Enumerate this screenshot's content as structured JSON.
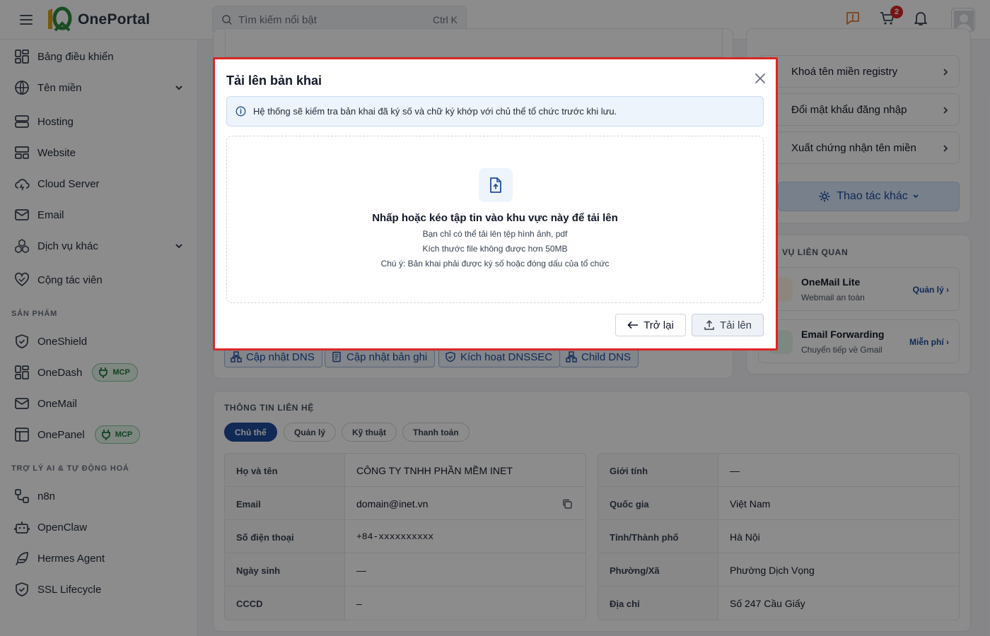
{
  "app": {
    "name": "OnePortal"
  },
  "search": {
    "placeholder": "Tìm kiếm nổi bật",
    "shortcut": "Ctrl K"
  },
  "header": {
    "cart_count": "2"
  },
  "sidebar": {
    "items": [
      {
        "label": "Bảng điều khiển",
        "icon": "dashboard-icon"
      },
      {
        "label": "Tên miền",
        "icon": "globe-icon",
        "expandable": true
      },
      {
        "label": "Hosting",
        "icon": "server-icon"
      },
      {
        "label": "Website",
        "icon": "website-icon"
      },
      {
        "label": "Cloud Server",
        "icon": "cloud-icon"
      },
      {
        "label": "Email",
        "icon": "mail-icon"
      },
      {
        "label": "Dịch vụ khác",
        "icon": "boxes-icon",
        "expandable": true
      },
      {
        "label": "Cộng tác viên",
        "icon": "handshake-icon"
      }
    ],
    "products_title": "SẢN PHẨM",
    "products": [
      {
        "label": "OneShield",
        "icon": "shield-icon"
      },
      {
        "label": "OneDash",
        "icon": "dashboard-icon",
        "badge": "MCP"
      },
      {
        "label": "OneMail",
        "icon": "mail-icon"
      },
      {
        "label": "OnePanel",
        "icon": "panel-icon",
        "badge": "MCP"
      }
    ],
    "ai_title": "TRỢ LÝ AI & TỰ ĐỘNG HOÁ",
    "ai": [
      {
        "label": "n8n",
        "icon": "workflow-icon"
      },
      {
        "label": "OpenClaw",
        "icon": "robot-icon"
      },
      {
        "label": "Hermes Agent",
        "icon": "feather-icon"
      },
      {
        "label": "SSL Lifecycle",
        "icon": "shield-check-icon"
      }
    ]
  },
  "actions": [
    {
      "label": "Khoá tên miền registry"
    },
    {
      "label": "Đổi mật khẩu đăng nhập"
    },
    {
      "label": "Xuất chứng nhận tên miền"
    }
  ],
  "more_actions": "Thao tác khác",
  "related": {
    "title": "VỤ LIÊN QUAN",
    "items": [
      {
        "name": "OneMail Lite",
        "sub": "Webmail an toàn",
        "link": "Quản lý ›"
      },
      {
        "name": "Email Forwarding",
        "sub": "Chuyển tiếp về Gmail",
        "link": "Miễn phí ›"
      }
    ]
  },
  "dns_buttons": [
    "Cập nhật DNS",
    "Cập nhật bản ghi",
    "Kích hoạt DNSSEC",
    "Child DNS"
  ],
  "contact": {
    "title": "THÔNG TIN LIÊN HỆ",
    "tabs": [
      "Chủ thể",
      "Quản lý",
      "Kỹ thuật",
      "Thanh toán"
    ],
    "active_tab": "Chủ thể",
    "left": [
      {
        "label": "Họ và tên",
        "value": "CÔNG TY TNHH PHẦN MỀM INET"
      },
      {
        "label": "Email",
        "value": "domain@inet.vn"
      },
      {
        "label": "Số điện thoại",
        "value": "+84-xxxxxxxxxx"
      },
      {
        "label": "Ngày sinh",
        "value": "—"
      },
      {
        "label": "CCCD",
        "value": "–"
      }
    ],
    "right": [
      {
        "label": "Giới tính",
        "value": "—"
      },
      {
        "label": "Quốc gia",
        "value": "Việt Nam"
      },
      {
        "label": "Tỉnh/Thành phố",
        "value": "Hà Nội"
      },
      {
        "label": "Phường/Xã",
        "value": "Phường Dịch Vọng"
      },
      {
        "label": "Địa chỉ",
        "value": "Số 247 Cầu Giấy"
      }
    ]
  },
  "modal": {
    "title": "Tải lên bản khai",
    "info": "Hệ thống sẽ kiểm tra bản khai đã ký số và chữ ký khớp với chủ thể tổ chức trước khi lưu.",
    "drop_main": "Nhấp hoặc kéo tập tin vào khu vực này để tải lên",
    "drop_line1": "Bạn chỉ có thể tải lên tệp hình ảnh, pdf",
    "drop_line2": "Kích thước file không được hơn 50MB",
    "drop_line3": "Chú ý: Bản khai phải được ký số hoặc đóng dấu của tổ chức",
    "back_label": "Trở lại",
    "upload_label": "Tải lên"
  },
  "colors": {
    "primary": "#1e4b9c",
    "danger": "#dc2626",
    "mcp_green": "#1f7a3d",
    "logo_green": "#2e8b3e",
    "logo_yellow": "#d4a017"
  }
}
